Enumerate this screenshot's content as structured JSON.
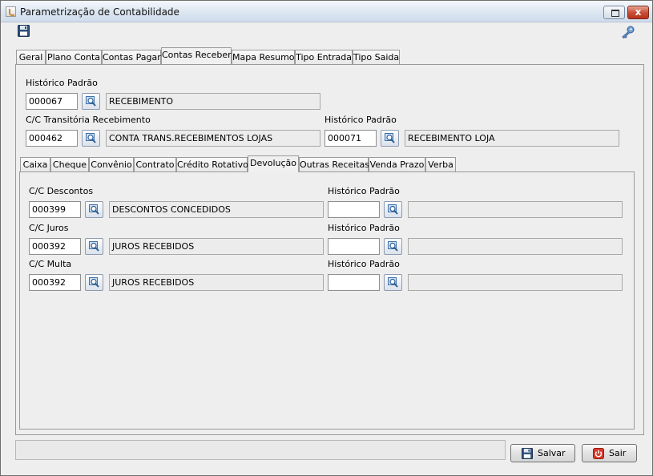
{
  "window": {
    "title": "Parametrização de Contabilidade",
    "close_symbol": "x"
  },
  "colors": {
    "accent": "#3b6db0",
    "close_red": "#c9503b"
  },
  "icons": {
    "toolbar_left": "save-icon",
    "toolbar_right": "key-icon",
    "lookup": "magnifier-icon"
  },
  "main_tabs": [
    "Geral",
    "Plano Conta",
    "Contas Pagar",
    "Contas Receber",
    "Mapa Resumo",
    "Tipo Entrada",
    "Tipo Saida"
  ],
  "main_tab_selected": "Contas Receber",
  "contas_receber": {
    "hist_label": "Histórico Padrão",
    "hist_code": "000067",
    "hist_desc": "RECEBIMENTO",
    "cc_trans_label": "C/C Transitória Recebimento",
    "cc_trans_code": "000462",
    "cc_trans_desc": "CONTA TRANS.RECEBIMENTOS LOJAS",
    "hist2_label": "Histórico Padrão",
    "hist2_code": "000071",
    "hist2_desc": "RECEBIMENTO LOJA"
  },
  "sub_tabs": [
    "Caixa",
    "Cheque",
    "Convênio",
    "Contrato",
    "Crédito Rotativo",
    "Devolução",
    "Outras Receitas",
    "Venda Prazo",
    "Verba"
  ],
  "sub_tab_selected": "Devolução",
  "devolucao": [
    {
      "label": "C/C Descontos",
      "code": "000399",
      "desc": "DESCONTOS CONCEDIDOS",
      "hist_label": "Histórico Padrão",
      "hist_code": "",
      "hist_desc": ""
    },
    {
      "label": "C/C Juros",
      "code": "000392",
      "desc": "JUROS RECEBIDOS",
      "hist_label": "Histórico Padrão",
      "hist_code": "",
      "hist_desc": ""
    },
    {
      "label": "C/C Multa",
      "code": "000392",
      "desc": "JUROS RECEBIDOS",
      "hist_label": "Histórico Padrão",
      "hist_code": "",
      "hist_desc": ""
    }
  ],
  "buttons": {
    "save": "Salvar",
    "exit": "Sair"
  }
}
